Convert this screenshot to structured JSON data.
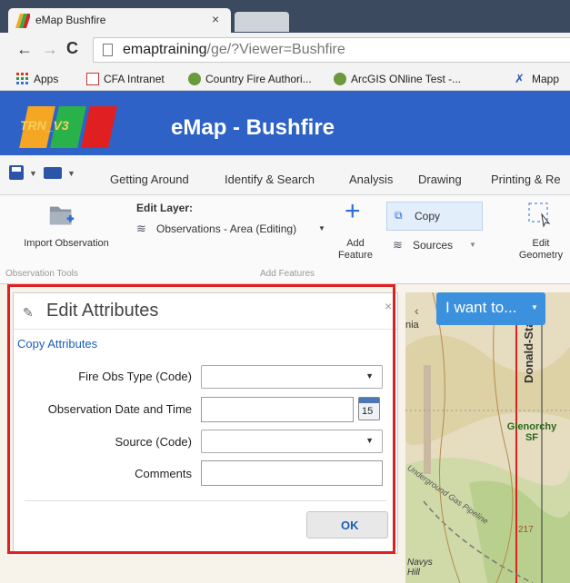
{
  "browser": {
    "tab_title": "eMap Bushfire",
    "tab_close": "×",
    "url_host": "emaptraining",
    "url_path": "/ge/?Viewer=Bushfire",
    "bookmarks": [
      {
        "label": "Apps"
      },
      {
        "label": "CFA Intranet"
      },
      {
        "label": "Country Fire Authori..."
      },
      {
        "label": "ArcGIS ONline Test -..."
      },
      {
        "label": "Mapp"
      }
    ]
  },
  "app": {
    "logo_text": "TRN_V3",
    "title": "eMap - Bushfire",
    "logo_colors": [
      "#f5a623",
      "#2ab24a",
      "#e02020"
    ],
    "header_color": "#2f62c7"
  },
  "menu": {
    "items": [
      "Getting Around",
      "Identify & Search",
      "Analysis",
      "Drawing",
      "Printing & Re"
    ]
  },
  "ribbon": {
    "import_label": "Import Observation",
    "group_observation": "Observation Tools",
    "edit_layer_label": "Edit Layer:",
    "edit_layer_value": "Observations - Area (Editing)",
    "add_feature_label": "Add Feature",
    "copy_label": "Copy",
    "sources_label": "Sources",
    "group_add": "Add Features",
    "edit_geometry_label": "Edit Geometry"
  },
  "map": {
    "iwant_label": "I want to...",
    "labels": [
      "Donald-Staw",
      "Glenorchy SF",
      "Underground Gas Pipeline",
      "Navys Hill",
      "nia",
      "217"
    ]
  },
  "dialog": {
    "title": "Edit Attributes",
    "close": "×",
    "copy_attributes": "Copy Attributes",
    "fields": {
      "fire_obs_type": {
        "label": "Fire Obs Type (Code)",
        "value": ""
      },
      "obs_datetime": {
        "label": "Observation Date and Time",
        "value": ""
      },
      "source": {
        "label": "Source (Code)",
        "value": ""
      },
      "comments": {
        "label": "Comments",
        "value": ""
      }
    },
    "calendar_day": "15",
    "ok_label": "OK"
  }
}
